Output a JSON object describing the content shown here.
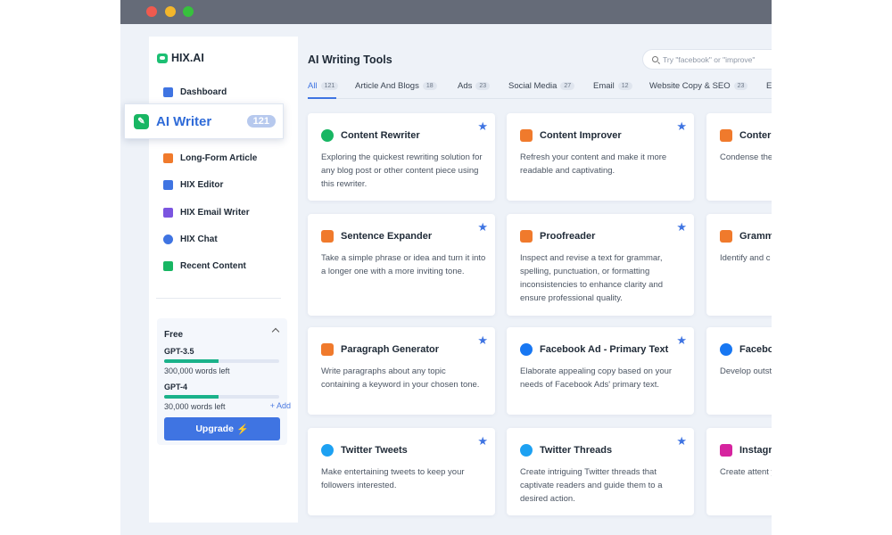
{
  "sidebar": {
    "logo": "HIX.AI",
    "nav": [
      {
        "label": "Dashboard",
        "icon": "home-icon",
        "color": "#3f74e2"
      },
      {
        "label": "Long-Form Article",
        "icon": "document-icon",
        "color": "#f07a2c"
      },
      {
        "label": "HIX Editor",
        "icon": "editor-icon",
        "color": "#3f74e2"
      },
      {
        "label": "HIX Email Writer",
        "icon": "email-icon",
        "color": "#7b55e0"
      },
      {
        "label": "HIX Chat",
        "icon": "chat-icon",
        "color": "#3f74e2"
      },
      {
        "label": "Recent Content",
        "icon": "recent-icon",
        "color": "#18b663"
      }
    ],
    "ai_writer": {
      "label": "AI Writer",
      "count": "121"
    },
    "plan": {
      "title": "Free",
      "gpt35": {
        "label": "GPT-3.5",
        "words": "300,000 words left",
        "fill": 0.47
      },
      "gpt4": {
        "label": "GPT-4",
        "words": "30,000 words left",
        "fill": 0.47
      },
      "add": "+ Add",
      "upgrade": "Upgrade"
    }
  },
  "main": {
    "title": "AI Writing Tools",
    "search_placeholder": "Try \"facebook\" or \"improve\"",
    "tabs": [
      {
        "label": "All",
        "count": "121"
      },
      {
        "label": "Article And Blogs",
        "count": "18"
      },
      {
        "label": "Ads",
        "count": "23"
      },
      {
        "label": "Social Media",
        "count": "27"
      },
      {
        "label": "Email",
        "count": "12"
      },
      {
        "label": "Website Copy & SEO",
        "count": "23"
      },
      {
        "label": "E",
        "count": ""
      }
    ],
    "cards": [
      {
        "title": "Content Rewriter",
        "desc": "Exploring the quickest rewriting solution for any blog post or other content piece using this rewriter.",
        "icon": "rewrite-icon",
        "color": "#18b663"
      },
      {
        "title": "Content Improver",
        "desc": "Refresh your content and make it more readable and captivating.",
        "icon": "improve-icon",
        "color": "#f07a2c"
      },
      {
        "title": "Conter",
        "desc": "Condense the effective and",
        "icon": "condense-icon",
        "color": "#f07a2c"
      },
      {
        "title": "Sentence Expander",
        "desc": "Take a simple phrase or idea and turn it into a longer one with a more inviting tone.",
        "icon": "expand-icon",
        "color": "#f07a2c"
      },
      {
        "title": "Proofreader",
        "desc": "Inspect and revise a text for grammar, spelling, punctuation, or formatting inconsistencies to enhance clarity and ensure professional quality.",
        "icon": "proofread-icon",
        "color": "#f07a2c"
      },
      {
        "title": "Gramm",
        "desc": "Identify and c to improve cl credibility in a",
        "icon": "grammar-icon",
        "color": "#f07a2c"
      },
      {
        "title": "Paragraph Generator",
        "desc": "Write paragraphs about any topic containing a keyword in your chosen tone.",
        "icon": "paragraph-icon",
        "color": "#f07a2c"
      },
      {
        "title": "Facebook Ad - Primary Text",
        "desc": "Elaborate appealing copy based on your needs of Facebook Ads' primary text.",
        "icon": "facebook-icon",
        "color": "#1877f2"
      },
      {
        "title": "Facebo",
        "desc": "Develop outst purpose of yo",
        "icon": "facebook-icon",
        "color": "#1877f2"
      },
      {
        "title": "Twitter Tweets",
        "desc": "Make entertaining tweets to keep your followers interested.",
        "icon": "twitter-icon",
        "color": "#1da1f2"
      },
      {
        "title": "Twitter Threads",
        "desc": "Create intriguing Twitter threads that captivate readers and guide them to a desired action.",
        "icon": "twitter-icon",
        "color": "#1da1f2"
      },
      {
        "title": "Instagr",
        "desc": "Create attent your posts on",
        "icon": "instagram-icon",
        "color": "#d6249f"
      }
    ]
  }
}
